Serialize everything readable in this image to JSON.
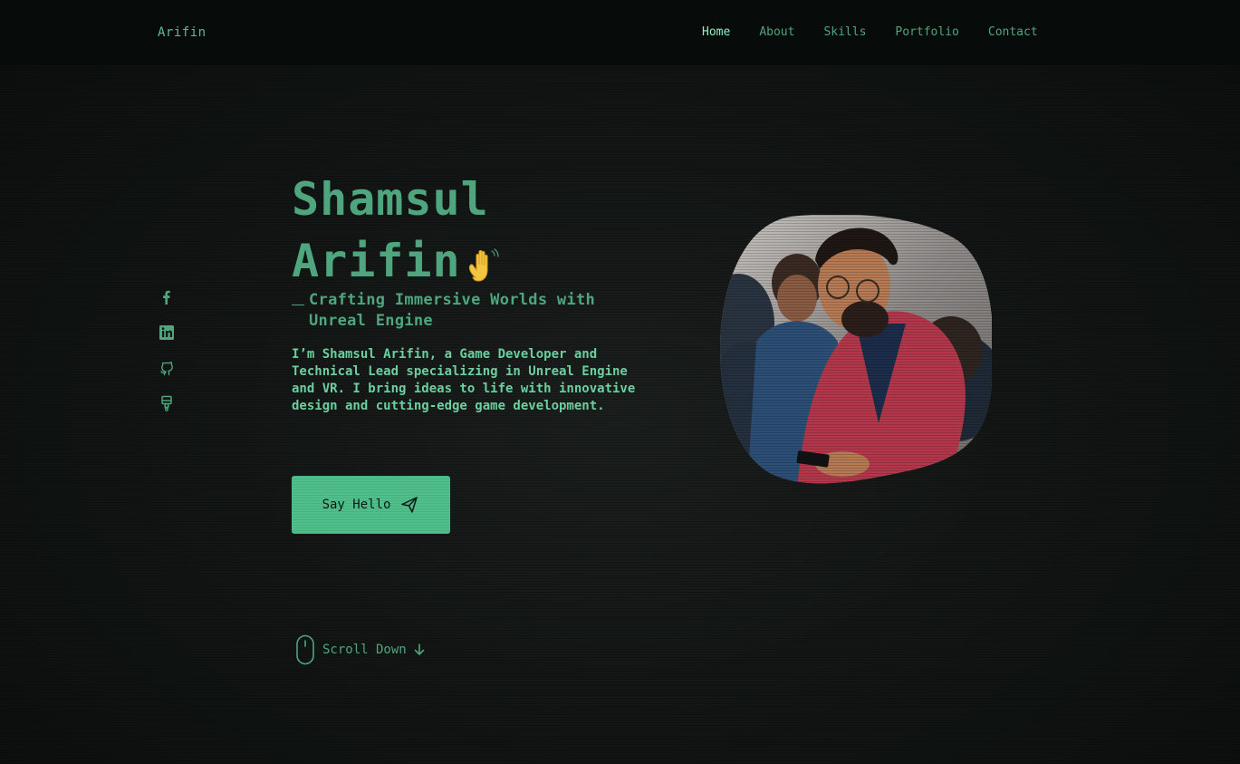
{
  "header": {
    "logo": "Arifin",
    "nav": [
      {
        "label": "Home",
        "active": true
      },
      {
        "label": "About",
        "active": false
      },
      {
        "label": "Skills",
        "active": false
      },
      {
        "label": "Portfolio",
        "active": false
      },
      {
        "label": "Contact",
        "active": false
      }
    ]
  },
  "socials": [
    {
      "icon": "facebook-icon"
    },
    {
      "icon": "linkedin-icon"
    },
    {
      "icon": "github-icon"
    },
    {
      "icon": "brush-icon"
    }
  ],
  "hero": {
    "name_line1": "Shamsul",
    "name_line2": "Arifin",
    "wave_icon": "waving-hand-icon",
    "subtitle": "Crafting Immersive Worlds with Unreal Engine",
    "description": "I’m Shamsul Arifin, a Game Developer and Technical Lead specializing in Unreal Engine and VR. I bring ideas to life with innovative design and cutting-edge game development.",
    "cta_label": "Say Hello",
    "cta_icon": "send-icon",
    "scroll_label": "Scroll Down",
    "scroll_icon": "mouse-icon"
  },
  "colors": {
    "accent": "#4fa57d",
    "accent_bright": "#8ef0c0",
    "button": "#4fbf8c",
    "background": "#0d1210"
  }
}
